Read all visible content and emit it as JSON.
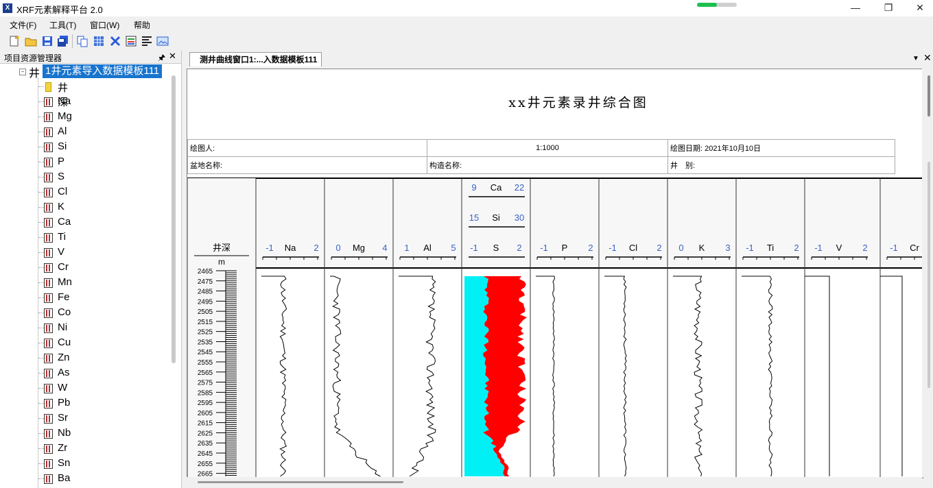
{
  "window": {
    "title": "XRF元素解释平台 2.0",
    "progress": 0.5
  },
  "menu": [
    "文件(F)",
    "工具(T)",
    "窗口(W)",
    "帮助"
  ],
  "toolbar": [
    "new-file-icon",
    "open-folder-icon",
    "save-icon",
    "save-all-icon",
    "copy-icon",
    "grid-icon",
    "delete-icon",
    "chart-icon",
    "align-icon",
    "image-icon"
  ],
  "left_panel": {
    "title": "项目资源管理器",
    "root": "1井元素导入数据模板111",
    "nodes": [
      "井深",
      "Na",
      "Mg",
      "Al",
      "Si",
      "P",
      "S",
      "Cl",
      "K",
      "Ca",
      "Ti",
      "V",
      "Cr",
      "Mn",
      "Fe",
      "Co",
      "Ni",
      "Cu",
      "Zn",
      "As",
      "W",
      "Pb",
      "Sr",
      "Nb",
      "Zr",
      "Sn",
      "Ba"
    ]
  },
  "tab": {
    "label": "测井曲线窗口1:...入数据模板111"
  },
  "chart": {
    "title": "xx井元素录井综合图",
    "info": {
      "drawer_label": "绘图人:",
      "scale": "1:1000",
      "date_label": "绘图日期: 2021年10月10日",
      "basin_label": "盆地名称:",
      "structure_label": "构造名称:",
      "well_type_label": "井　别:"
    },
    "depth_header": "井深",
    "depth_unit": "m",
    "colors": {
      "si_fill": "#00f0f5",
      "s_fill": "#ff0000",
      "scale_num": "#3a62c4"
    }
  },
  "chart_data": {
    "type": "line",
    "y_axis": {
      "label": "井深",
      "unit": "m",
      "ticks": [
        2465,
        2475,
        2485,
        2495,
        2505,
        2515,
        2525,
        2535,
        2545,
        2555,
        2565,
        2575,
        2585,
        2595,
        2605,
        2615,
        2625,
        2635,
        2645,
        2655,
        2665
      ],
      "range": [
        2465,
        2668
      ]
    },
    "tracks": [
      {
        "name": "Na",
        "min": "-1",
        "max": "2"
      },
      {
        "name": "Mg",
        "min": "0",
        "max": "4"
      },
      {
        "name": "Al",
        "min": "1",
        "max": "5"
      },
      {
        "name": "Ca",
        "min": "9",
        "max": "22",
        "stack": "1"
      },
      {
        "name": "Si",
        "min": "15",
        "max": "30",
        "stack": "1",
        "fill": "#00f0f5"
      },
      {
        "name": "S",
        "min": "-1",
        "max": "2",
        "stack": "1",
        "fill": "#ff0000"
      },
      {
        "name": "P",
        "min": "-1",
        "max": "2"
      },
      {
        "name": "Cl",
        "min": "-1",
        "max": "2"
      },
      {
        "name": "K",
        "min": "0",
        "max": "3"
      },
      {
        "name": "Ti",
        "min": "-1",
        "max": "2"
      },
      {
        "name": "V",
        "min": "-1",
        "max": "2"
      },
      {
        "name": "Cr",
        "min": "-1",
        "max": ""
      }
    ]
  }
}
